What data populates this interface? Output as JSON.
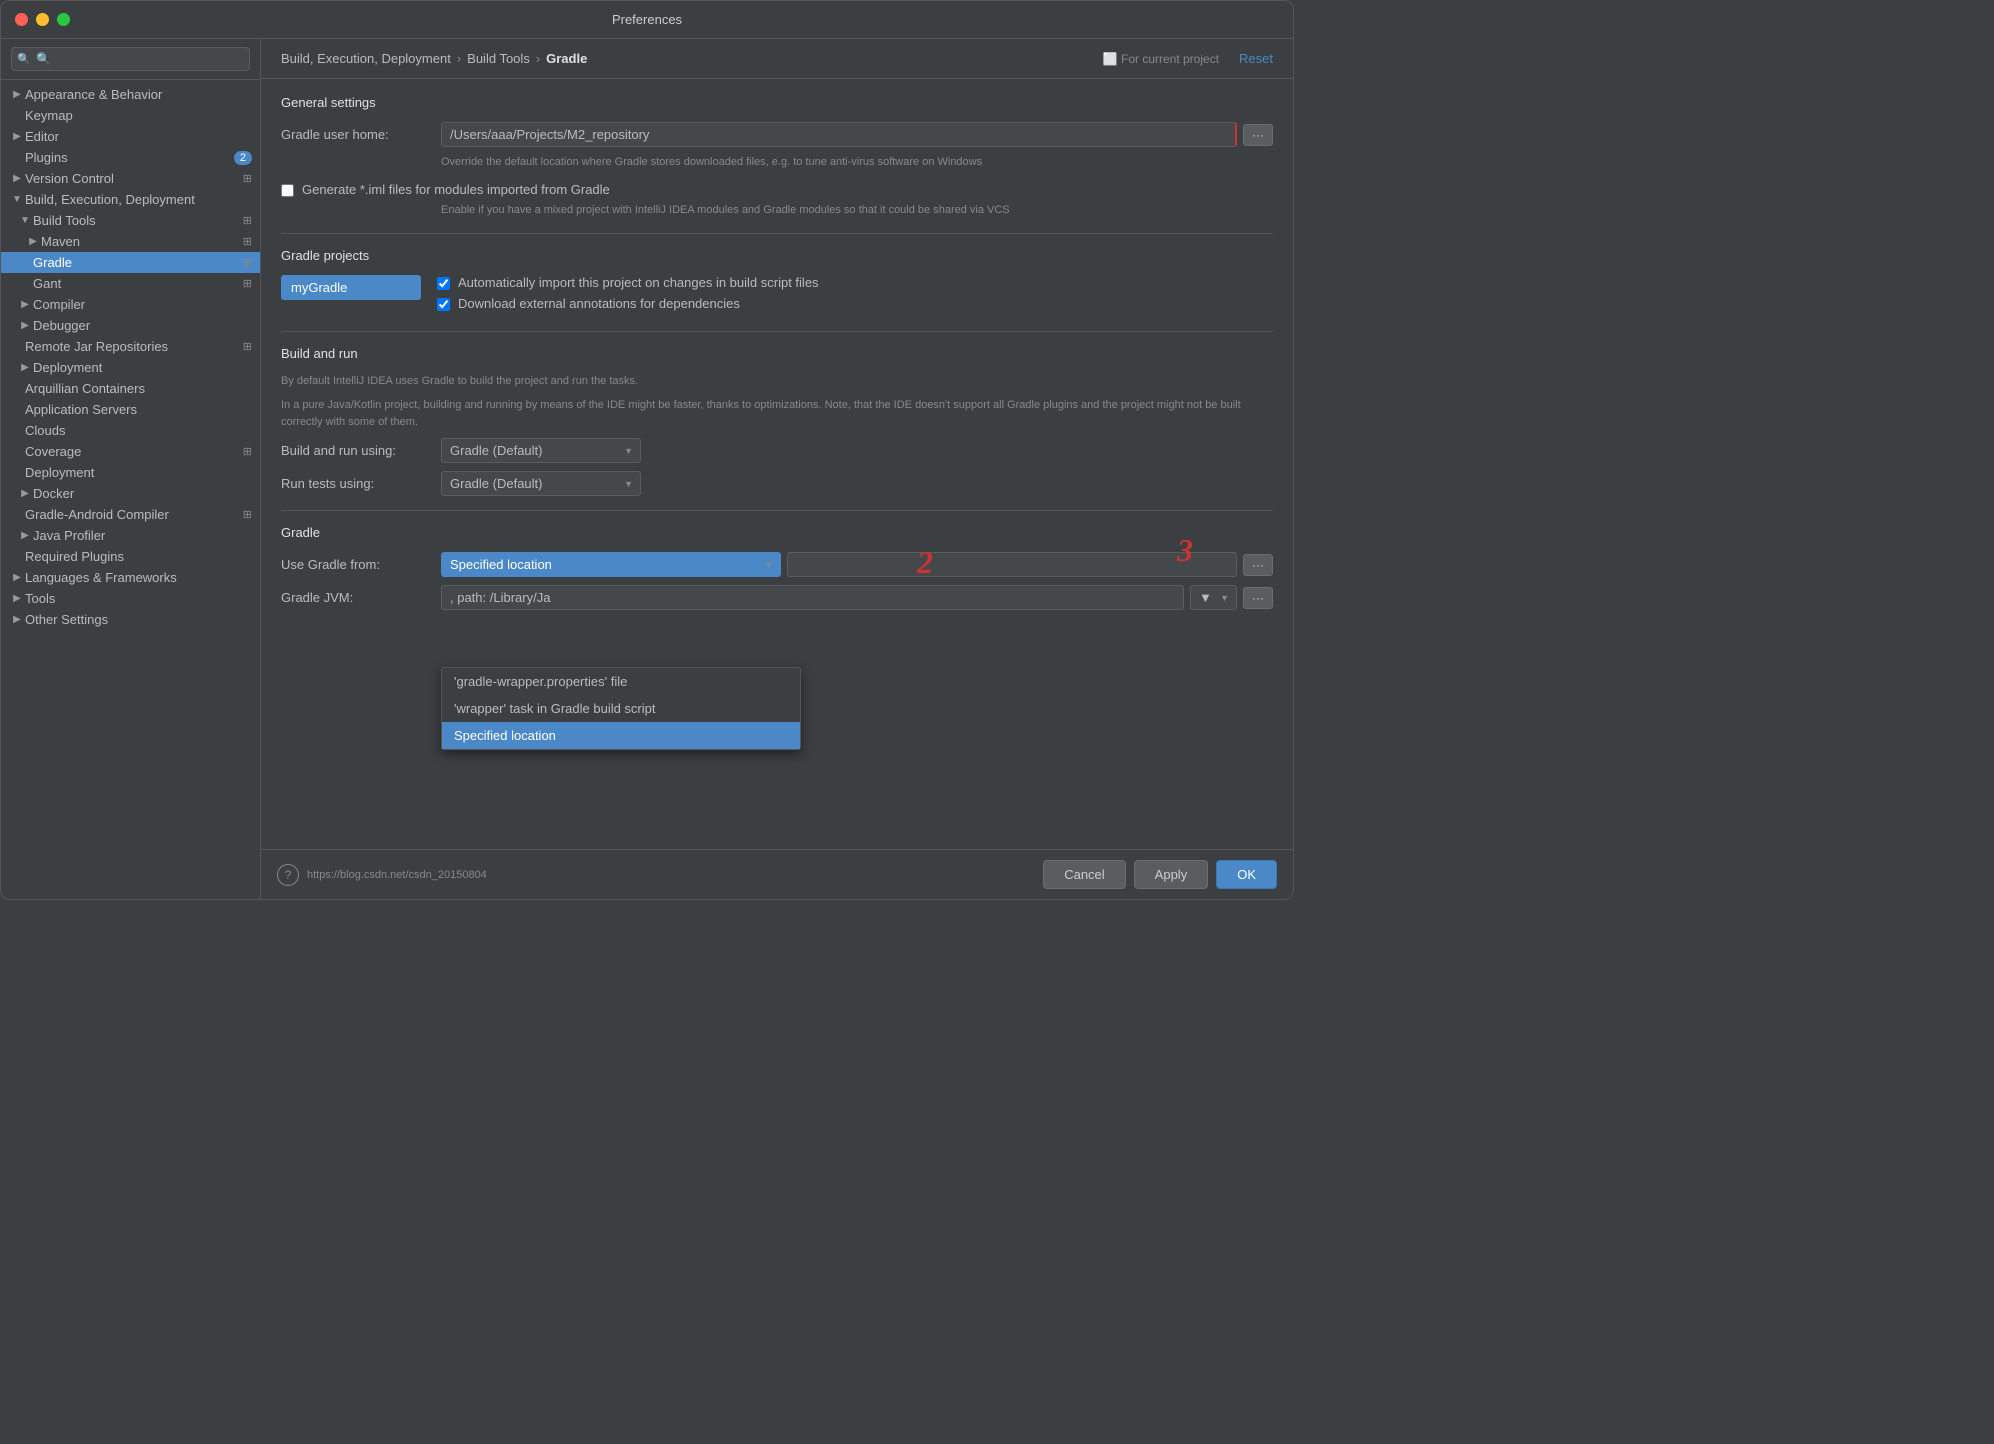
{
  "window": {
    "title": "Preferences"
  },
  "titlebar": {
    "close_label": "",
    "minimize_label": "",
    "maximize_label": ""
  },
  "sidebar": {
    "search_placeholder": "🔍",
    "items": [
      {
        "id": "appearance",
        "label": "Appearance & Behavior",
        "level": 0,
        "arrow": "▶",
        "expanded": false
      },
      {
        "id": "keymap",
        "label": "Keymap",
        "level": 0,
        "arrow": "",
        "expanded": false
      },
      {
        "id": "editor",
        "label": "Editor",
        "level": 0,
        "arrow": "▶",
        "expanded": false
      },
      {
        "id": "plugins",
        "label": "Plugins",
        "level": 0,
        "badge": "2"
      },
      {
        "id": "version-control",
        "label": "Version Control",
        "level": 0,
        "arrow": "▶"
      },
      {
        "id": "build-exec-deploy",
        "label": "Build, Execution, Deployment",
        "level": 0,
        "arrow": "▼",
        "expanded": true
      },
      {
        "id": "build-tools",
        "label": "Build Tools",
        "level": 1,
        "arrow": "▼",
        "expanded": true
      },
      {
        "id": "maven",
        "label": "Maven",
        "level": 2,
        "arrow": "▶"
      },
      {
        "id": "gradle",
        "label": "Gradle",
        "level": 2,
        "arrow": "",
        "selected": true
      },
      {
        "id": "gant",
        "label": "Gant",
        "level": 2,
        "arrow": ""
      },
      {
        "id": "compiler",
        "label": "Compiler",
        "level": 1,
        "arrow": "▶"
      },
      {
        "id": "debugger",
        "label": "Debugger",
        "level": 1,
        "arrow": "▶"
      },
      {
        "id": "remote-jar",
        "label": "Remote Jar Repositories",
        "level": 1
      },
      {
        "id": "deployment",
        "label": "Deployment",
        "level": 1,
        "arrow": "▶"
      },
      {
        "id": "arquillian",
        "label": "Arquillian Containers",
        "level": 1
      },
      {
        "id": "app-servers",
        "label": "Application Servers",
        "level": 1
      },
      {
        "id": "clouds",
        "label": "Clouds",
        "level": 1
      },
      {
        "id": "coverage",
        "label": "Coverage",
        "level": 1
      },
      {
        "id": "deployment2",
        "label": "Deployment",
        "level": 1
      },
      {
        "id": "docker",
        "label": "Docker",
        "level": 1,
        "arrow": "▶"
      },
      {
        "id": "gradle-android",
        "label": "Gradle-Android Compiler",
        "level": 1
      },
      {
        "id": "java-profiler",
        "label": "Java Profiler",
        "level": 1,
        "arrow": "▶"
      },
      {
        "id": "required-plugins",
        "label": "Required Plugins",
        "level": 1
      },
      {
        "id": "lang-frameworks",
        "label": "Languages & Frameworks",
        "level": 0,
        "arrow": "▶"
      },
      {
        "id": "tools",
        "label": "Tools",
        "level": 0,
        "arrow": "▶"
      },
      {
        "id": "other-settings",
        "label": "Other Settings",
        "level": 0,
        "arrow": "▶"
      }
    ]
  },
  "breadcrumb": {
    "part1": "Build, Execution, Deployment",
    "sep1": "›",
    "part2": "Build Tools",
    "sep2": "›",
    "part3": "Gradle",
    "for_current": "⬜ For current project",
    "reset": "Reset"
  },
  "content": {
    "general_settings_title": "General settings",
    "gradle_user_home_label": "Gradle user home:",
    "gradle_user_home_value": "/Users/aaa/Projects/M2_repository",
    "gradle_user_home_hint": "Override the default location where Gradle stores downloaded files, e.g. to tune anti-virus software on Windows",
    "generate_iml_label": "Generate *.iml files for modules imported from Gradle",
    "generate_iml_hint": "Enable if you have a mixed project with IntelliJ IDEA modules and Gradle modules so that it could be shared via VCS",
    "gradle_projects_title": "Gradle projects",
    "project_name": "myGradle",
    "auto_import_label": "Automatically import this project on changes in build script files",
    "download_annotations_label": "Download external annotations for dependencies",
    "build_run_title": "Build and run",
    "build_run_desc1": "By default IntelliJ IDEA uses Gradle to build the project and run the tasks.",
    "build_run_desc2": "In a pure Java/Kotlin project, building and running by means of the IDE might be faster, thanks to optimizations. Note, that the IDE doesn't support all Gradle plugins and the project might not be built correctly with some of them.",
    "build_run_using_label": "Build and run using:",
    "build_run_using_value": "Gradle (Default)",
    "run_tests_label": "Run tests using:",
    "run_tests_value": "Gradle (Default)",
    "gradle_section_title": "Gradle",
    "use_gradle_from_label": "Use Gradle from:",
    "use_gradle_from_value": "Specified location",
    "gradle_jvm_label": "Gradle JVM:",
    "gradle_jvm_value": ", path: /Library/Ja",
    "dropdown_options": [
      {
        "label": "'gradle-wrapper.properties' file",
        "selected": false
      },
      {
        "label": "'wrapper' task in Gradle build script",
        "selected": false
      },
      {
        "label": "Specified location",
        "selected": true
      }
    ]
  },
  "bottom": {
    "help_label": "?",
    "status_url": "https://blog.csdn.net/csdn_20150804",
    "cancel_label": "Cancel",
    "apply_label": "Apply",
    "ok_label": "OK"
  }
}
